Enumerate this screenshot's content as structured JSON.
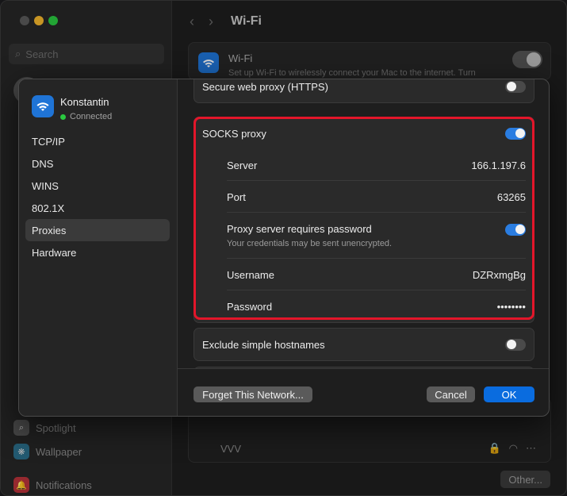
{
  "window": {
    "title": "Wi-Fi",
    "search_placeholder": "Search",
    "sidebar_items": [
      "Spotlight",
      "Wallpaper",
      "Notifications"
    ],
    "wifi_card": {
      "title": "Wi-Fi",
      "subtitle": "Set up Wi-Fi to wirelessly connect your Mac to the internet. Turn"
    },
    "networks": [
      {
        "name": "VVV"
      }
    ],
    "other_button": "Other..."
  },
  "sheet": {
    "network_name": "Konstantin",
    "network_status": "Connected",
    "nav": [
      "TCP/IP",
      "DNS",
      "WINS",
      "802.1X",
      "Proxies",
      "Hardware"
    ],
    "active_nav": "Proxies",
    "https_proxy": {
      "label": "Secure web proxy (HTTPS)",
      "enabled": false
    },
    "socks": {
      "label": "SOCKS proxy",
      "enabled": true,
      "server_label": "Server",
      "server_value": "166.1.197.6",
      "port_label": "Port",
      "port_value": "63265",
      "password_required_label": "Proxy server requires password",
      "password_required_hint": "Your credentials may be sent unencrypted.",
      "password_required": true,
      "username_label": "Username",
      "username_value": "DZRxmgBg",
      "password_label": "Password",
      "password_value": "••••••••"
    },
    "exclude_simple": {
      "label": "Exclude simple hostnames",
      "enabled": false
    },
    "buttons": {
      "forget": "Forget This Network...",
      "cancel": "Cancel",
      "ok": "OK"
    }
  },
  "colors": {
    "accent": "#0a6cdf",
    "highlight_border": "#e3162a",
    "connected_dot": "#2ac940"
  }
}
